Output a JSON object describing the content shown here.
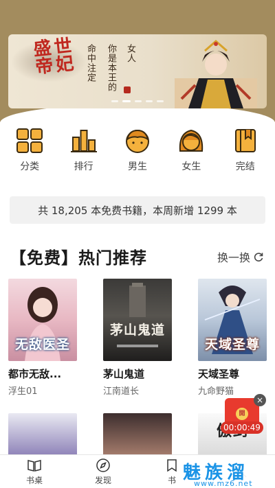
{
  "banner": {
    "title": "盛世帝妃",
    "tagline_lines": [
      "女人",
      "你是本王的",
      "命中注定"
    ]
  },
  "categories": [
    {
      "label": "分类",
      "icon": "grid-icon"
    },
    {
      "label": "排行",
      "icon": "bar-chart-icon"
    },
    {
      "label": "男生",
      "icon": "male-avatar-icon"
    },
    {
      "label": "女生",
      "icon": "female-avatar-icon"
    },
    {
      "label": "完结",
      "icon": "book-icon"
    }
  ],
  "stats_text": "共 18,205 本免费书籍，本周新增 1299 本",
  "section": {
    "title": "【免费】热门推荐",
    "refresh_label": "换一换"
  },
  "books": [
    {
      "title": "都市无敌...",
      "author": "浮生01",
      "cover_text": "无敌医圣"
    },
    {
      "title": "茅山鬼道",
      "author": "江南道长",
      "cover_text": "茅山鬼道"
    },
    {
      "title": "天域圣尊",
      "author": "九命野猫",
      "cover_text": "天域圣尊"
    }
  ],
  "books_row2": [
    {
      "cover_text": ""
    },
    {
      "cover_text": ""
    },
    {
      "cover_text": "傲剑"
    }
  ],
  "promo": {
    "close": "×",
    "coin": "開",
    "timer": "00:00:49"
  },
  "nav": [
    {
      "label": "书桌",
      "icon": "open-book-icon"
    },
    {
      "label": "发现",
      "icon": "compass-icon"
    },
    {
      "label": "书",
      "icon": "bookmark-icon"
    },
    {
      "label": "",
      "icon": "user-icon"
    }
  ],
  "watermark": {
    "text": "魅族溜",
    "url": "www.mz6.net"
  },
  "colors": {
    "accent": "#e09a2d",
    "banner_bg": "#a38c5e",
    "seal_red": "#c0281f"
  }
}
